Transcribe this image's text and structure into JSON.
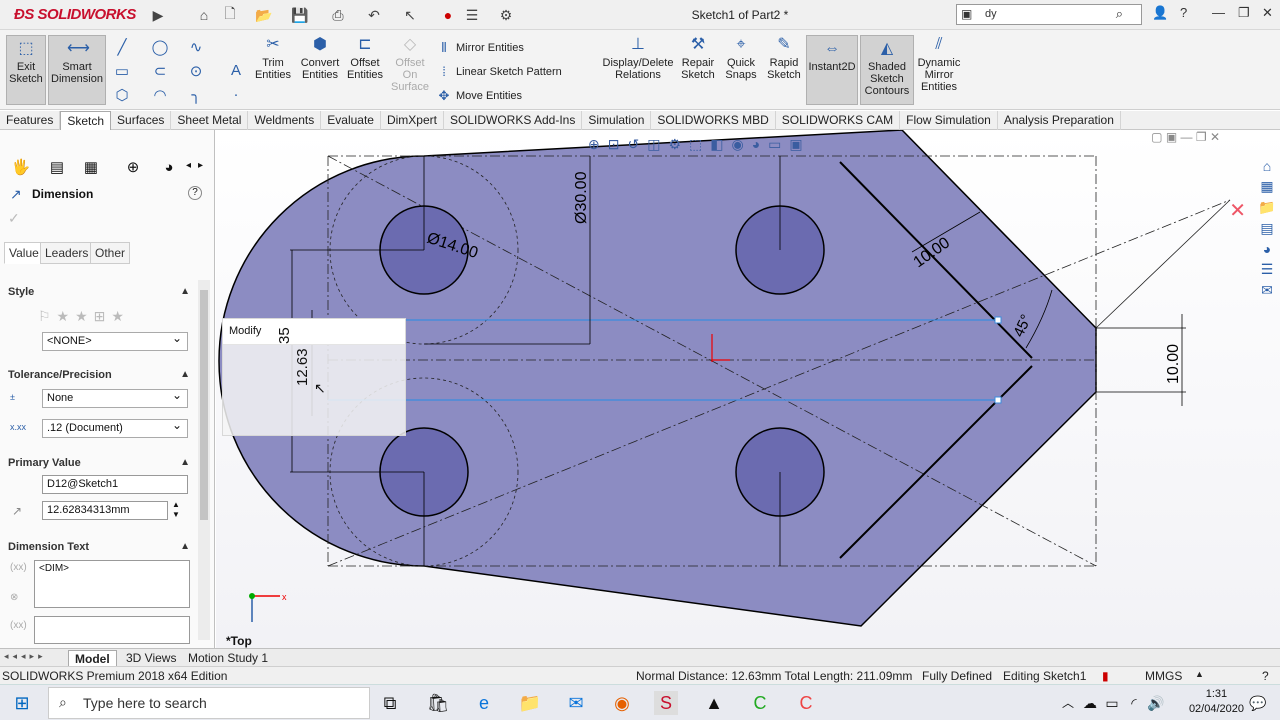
{
  "app": {
    "logo": "SOLIDWORKS",
    "doc_title": "Sketch1 of Part2 *"
  },
  "search": {
    "value": "dy"
  },
  "cmd": {
    "exit_sketch": "Exit Sketch",
    "smart_dimension": "Smart Dimension",
    "trim_entities": "Trim Entities",
    "convert_entities": "Convert Entities",
    "offset_entities": "Offset Entities",
    "offset_on_surface": "Offset On Surface",
    "mirror_entities": "Mirror Entities",
    "linear_sketch_pattern": "Linear Sketch Pattern",
    "move_entities": "Move Entities",
    "display_delete_relations": "Display/Delete Relations",
    "repair_sketch": "Repair Sketch",
    "quick_snaps": "Quick Snaps",
    "rapid_sketch": "Rapid Sketch",
    "instant2d": "Instant2D",
    "shaded_sketch_contours": "Shaded Sketch Contours",
    "dynamic_mirror_entities": "Dynamic Mirror Entities"
  },
  "tabs": [
    "Features",
    "Sketch",
    "Surfaces",
    "Sheet Metal",
    "Weldments",
    "Evaluate",
    "DimXpert",
    "SOLIDWORKS Add-Ins",
    "Simulation",
    "SOLIDWORKS MBD",
    "SOLIDWORKS CAM",
    "Flow Simulation",
    "Analysis Preparation"
  ],
  "panel": {
    "title": "Dimension",
    "subtabs": [
      "Value",
      "Leaders",
      "Other"
    ],
    "style_header": "Style",
    "style_value": "<NONE>",
    "tolerance_header": "Tolerance/Precision",
    "tolerance_value": "None",
    "precision_value": ".12 (Document)",
    "primary_header": "Primary Value",
    "primary_name": "D12@Sketch1",
    "primary_value": "12.62834313mm",
    "dimtext_header": "Dimension Text",
    "dimtext_value": "<DIM>"
  },
  "viewport": {
    "modify_title": "Modify",
    "view_label": "*Top",
    "dims": {
      "d30": "Ø30.00",
      "d14": "Ø14.00",
      "d10a": "10.00",
      "d45": "45°",
      "d10b": "10.00",
      "d1263": "12.63",
      "d35": "35"
    }
  },
  "bottom_tabs": [
    "Model",
    "3D Views",
    "Motion Study 1"
  ],
  "status": {
    "edition": "SOLIDWORKS Premium 2018 x64 Edition",
    "measure": "Normal Distance: 12.63mm Total Length: 211.09mm",
    "state": "Fully Defined",
    "editing": "Editing Sketch1",
    "units": "MMGS"
  },
  "taskbar": {
    "search_placeholder": "Type here to search",
    "time": "1:31",
    "date": "02/04/2020"
  }
}
